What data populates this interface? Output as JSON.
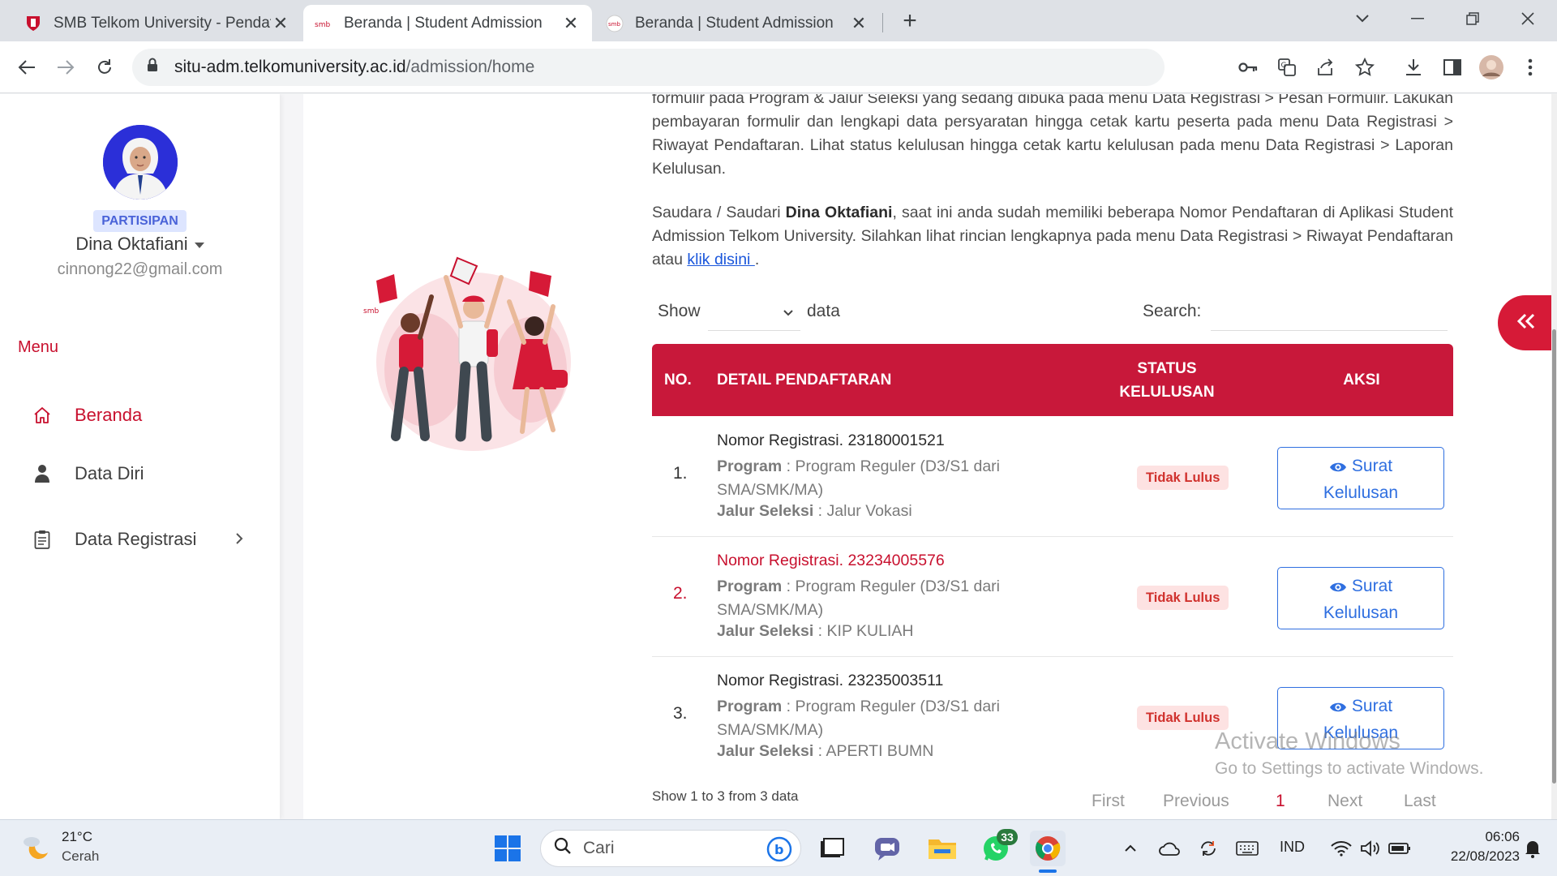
{
  "browser": {
    "tabs": [
      {
        "title": "SMB Telkom University - Pendaft"
      },
      {
        "title": "Beranda | Student Admission"
      },
      {
        "title": "Beranda | Student Admission"
      }
    ],
    "url_host": "situ-adm.telkomuniversity.ac.id",
    "url_path": "/admission/home"
  },
  "sidebar": {
    "role": "PARTISIPAN",
    "name": "Dina Oktafiani",
    "email": "cinnong22@gmail.com",
    "menu_title": "Menu",
    "items": [
      {
        "label": "Beranda"
      },
      {
        "label": "Data Diri"
      },
      {
        "label": "Data Registrasi"
      }
    ]
  },
  "content": {
    "para1": "formulir pada Program & Jalur Seleksi yang sedang dibuka pada menu Data Registrasi > Pesan Formulir. Lakukan pembayaran formulir dan lengkapi data persyaratan hingga cetak kartu peserta pada menu Data Registrasi > Riwayat Pendaftaran. Lihat status kelulusan hingga cetak kartu kelulusan pada menu Data Registrasi > Laporan Kelulusan.",
    "para2_pre": "Saudara / Saudari ",
    "para2_name": "Dina Oktafiani",
    "para2_mid": ", saat ini anda sudah memiliki beberapa Nomor Pendaftaran di Aplikasi Student Admission Telkom University. Silahkan lihat rincian lengkapnya pada menu Data Registrasi > Riwayat Pendaftaran atau ",
    "para2_link": "klik disini ",
    "para2_end": "."
  },
  "table": {
    "show_label": "Show",
    "data_label": "data",
    "search_label": "Search:",
    "headers": {
      "no": "NO.",
      "detail": "DETAIL PENDAFTARAN",
      "status_line1": "STATUS",
      "status_line2": "KELULUSAN",
      "aksi": "AKSI"
    },
    "program_label": "Program",
    "jalur_label": "Jalur Seleksi",
    "action_line1": "Surat",
    "action_line2": "Kelulusan",
    "rows": [
      {
        "no": "1.",
        "reg": "Nomor Registrasi. 23180001521",
        "program": "Program Reguler (D3/S1 dari SMA/SMK/MA)",
        "jalur": "Jalur Vokasi",
        "status": "Tidak Lulus"
      },
      {
        "no": "2.",
        "reg": "Nomor Registrasi. 23234005576",
        "program": "Program Reguler (D3/S1 dari SMA/SMK/MA)",
        "jalur": "KIP KULIAH",
        "status": "Tidak Lulus"
      },
      {
        "no": "3.",
        "reg": "Nomor Registrasi. 23235003511",
        "program": "Program Reguler (D3/S1 dari SMA/SMK/MA)",
        "jalur": "APERTI BUMN",
        "status": "Tidak Lulus"
      }
    ],
    "footer": "Show 1 to 3 from 3 data",
    "pagination": {
      "first": "First",
      "previous": "Previous",
      "current": "1",
      "next": "Next",
      "last": "Last"
    }
  },
  "watermark": {
    "line1": "Activate Windows",
    "line2": "Go to Settings to activate Windows."
  },
  "taskbar": {
    "temp": "21°C",
    "condition": "Cerah",
    "search_placeholder": "Cari",
    "whatsapp_badge": "33",
    "lang": "IND",
    "time": "06:06",
    "date": "22/08/2023"
  },
  "colors": {
    "brand_red": "#c8183a",
    "link_blue": "#1a56db",
    "action_blue": "#2f6fe0",
    "badge_bg": "#fde2e2"
  }
}
